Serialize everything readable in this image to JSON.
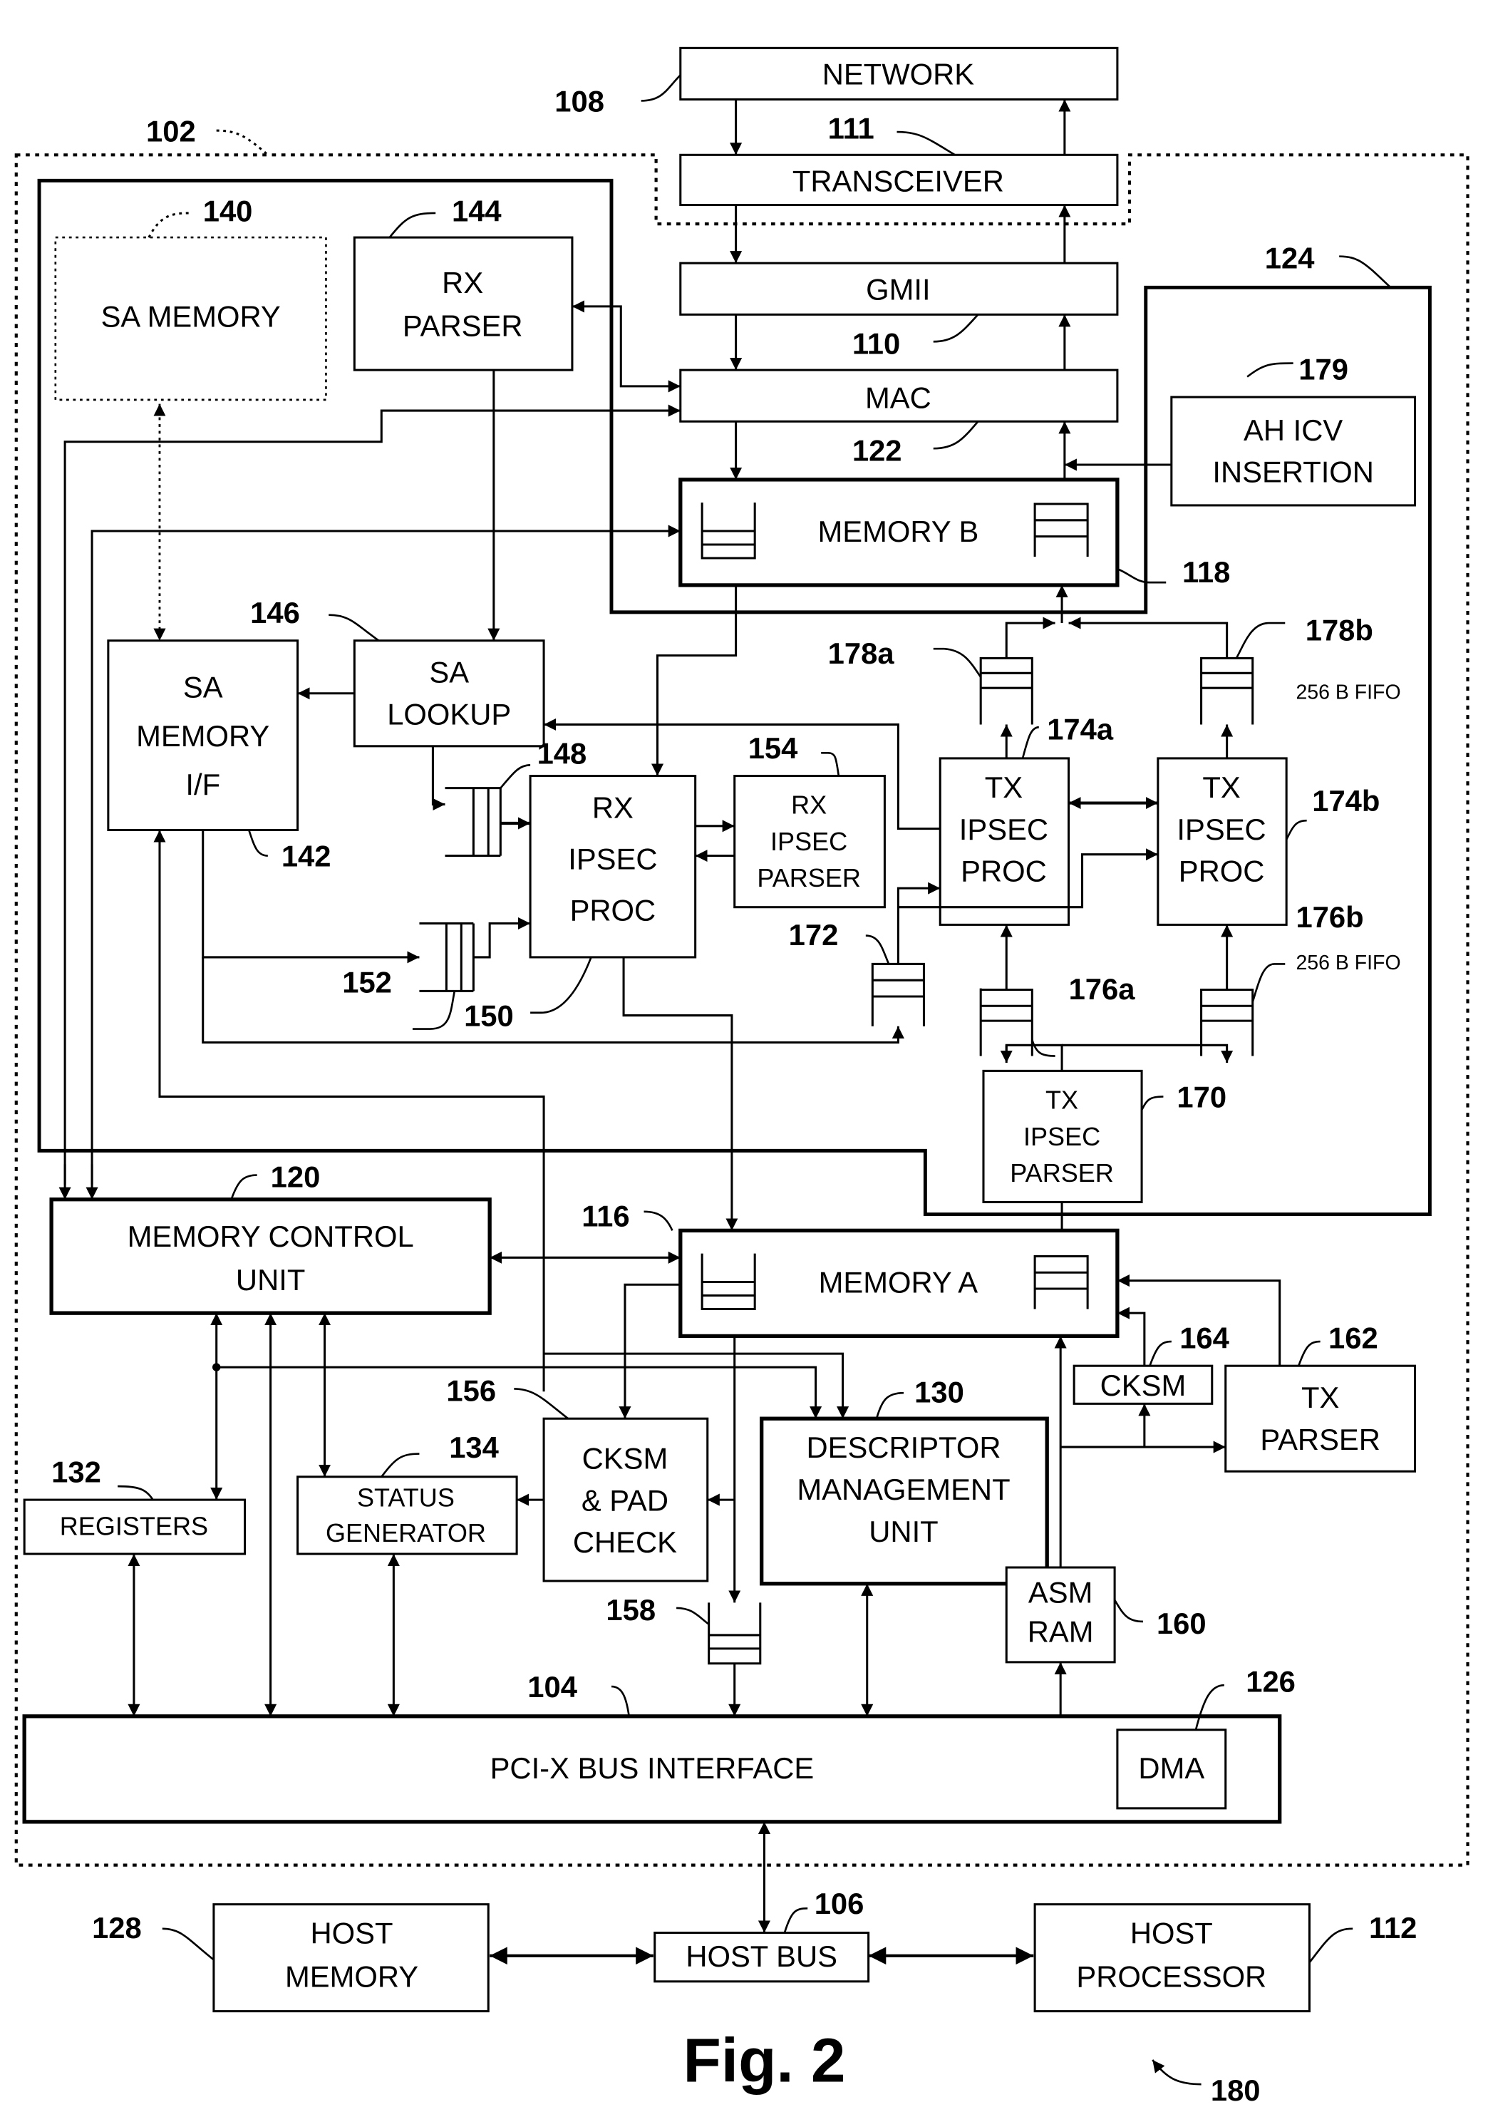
{
  "figure": {
    "caption": "Fig. 2",
    "system_ref": "180"
  },
  "enclosures": {
    "chip": {
      "ref": "102"
    },
    "security_block": {
      "ref": "124"
    }
  },
  "blocks": {
    "network": {
      "label": [
        "NETWORK"
      ],
      "ref": "108"
    },
    "transceiver": {
      "label": [
        "TRANSCEIVER"
      ],
      "ref": "111"
    },
    "gmii": {
      "label": [
        "GMII"
      ],
      "ref": "110"
    },
    "mac": {
      "label": [
        "MAC"
      ],
      "ref": "122"
    },
    "memory_b": {
      "label": [
        "MEMORY B"
      ],
      "ref": "118"
    },
    "ah_icv": {
      "label": [
        "AH ICV",
        "INSERTION"
      ],
      "ref": "179"
    },
    "sa_memory": {
      "label": [
        "SA MEMORY"
      ],
      "ref": "140"
    },
    "rx_parser": {
      "label": [
        "RX",
        "PARSER"
      ],
      "ref": "144"
    },
    "sa_lookup": {
      "label": [
        "SA",
        "LOOKUP"
      ],
      "ref": "146"
    },
    "sa_memory_if": {
      "label": [
        "SA",
        "MEMORY",
        "I/F"
      ],
      "ref": "142"
    },
    "rx_ipsec_proc": {
      "label": [
        "RX",
        "IPSEC",
        "PROC"
      ],
      "ref": "150"
    },
    "rx_ipsec_parser": {
      "label": [
        "RX",
        "IPSEC",
        "PARSER"
      ],
      "ref": "154"
    },
    "tx_ipsec_proc_a": {
      "label": [
        "TX",
        "IPSEC",
        "PROC"
      ],
      "ref": "174a"
    },
    "tx_ipsec_proc_b": {
      "label": [
        "TX",
        "IPSEC",
        "PROC"
      ],
      "ref": "174b"
    },
    "tx_ipsec_parser": {
      "label": [
        "TX",
        "IPSEC",
        "PARSER"
      ],
      "ref": "170"
    },
    "memory_control": {
      "label": [
        "MEMORY CONTROL",
        "UNIT"
      ],
      "ref": "120"
    },
    "memory_a": {
      "label": [
        "MEMORY A"
      ],
      "ref": "116"
    },
    "registers": {
      "label": [
        "REGISTERS"
      ],
      "ref": "132"
    },
    "status_generator": {
      "label": [
        "STATUS",
        "GENERATOR"
      ],
      "ref": "134"
    },
    "cksm_pad_check": {
      "label": [
        "CKSM",
        "& PAD",
        "CHECK"
      ],
      "ref": "156"
    },
    "descriptor_mgmt": {
      "label": [
        "DESCRIPTOR",
        "MANAGEMENT",
        "UNIT"
      ],
      "ref": "130"
    },
    "cksm": {
      "label": [
        "CKSM"
      ],
      "ref": "164"
    },
    "tx_parser": {
      "label": [
        "TX",
        "PARSER"
      ],
      "ref": "162"
    },
    "asm_ram": {
      "label": [
        "ASM",
        "RAM"
      ],
      "ref": "160"
    },
    "pcix": {
      "label": [
        "PCI-X BUS INTERFACE"
      ],
      "ref": "104"
    },
    "dma": {
      "label": [
        "DMA"
      ],
      "ref": "126"
    },
    "host_memory": {
      "label": [
        "HOST",
        "MEMORY"
      ],
      "ref": "128"
    },
    "host_bus": {
      "label": [
        "HOST BUS"
      ],
      "ref": "106"
    },
    "host_processor": {
      "label": [
        "HOST",
        "PROCESSOR"
      ],
      "ref": "112"
    }
  },
  "fifos": {
    "f148": {
      "ref": "148"
    },
    "f152": {
      "ref": "152"
    },
    "f158": {
      "ref": "158"
    },
    "f172": {
      "ref": "172"
    },
    "f176a": {
      "ref": "176a"
    },
    "f176b": {
      "ref": "176b",
      "note": "256 B FIFO"
    },
    "f178a": {
      "ref": "178a"
    },
    "f178b": {
      "ref": "178b",
      "note": "256 B FIFO"
    }
  }
}
